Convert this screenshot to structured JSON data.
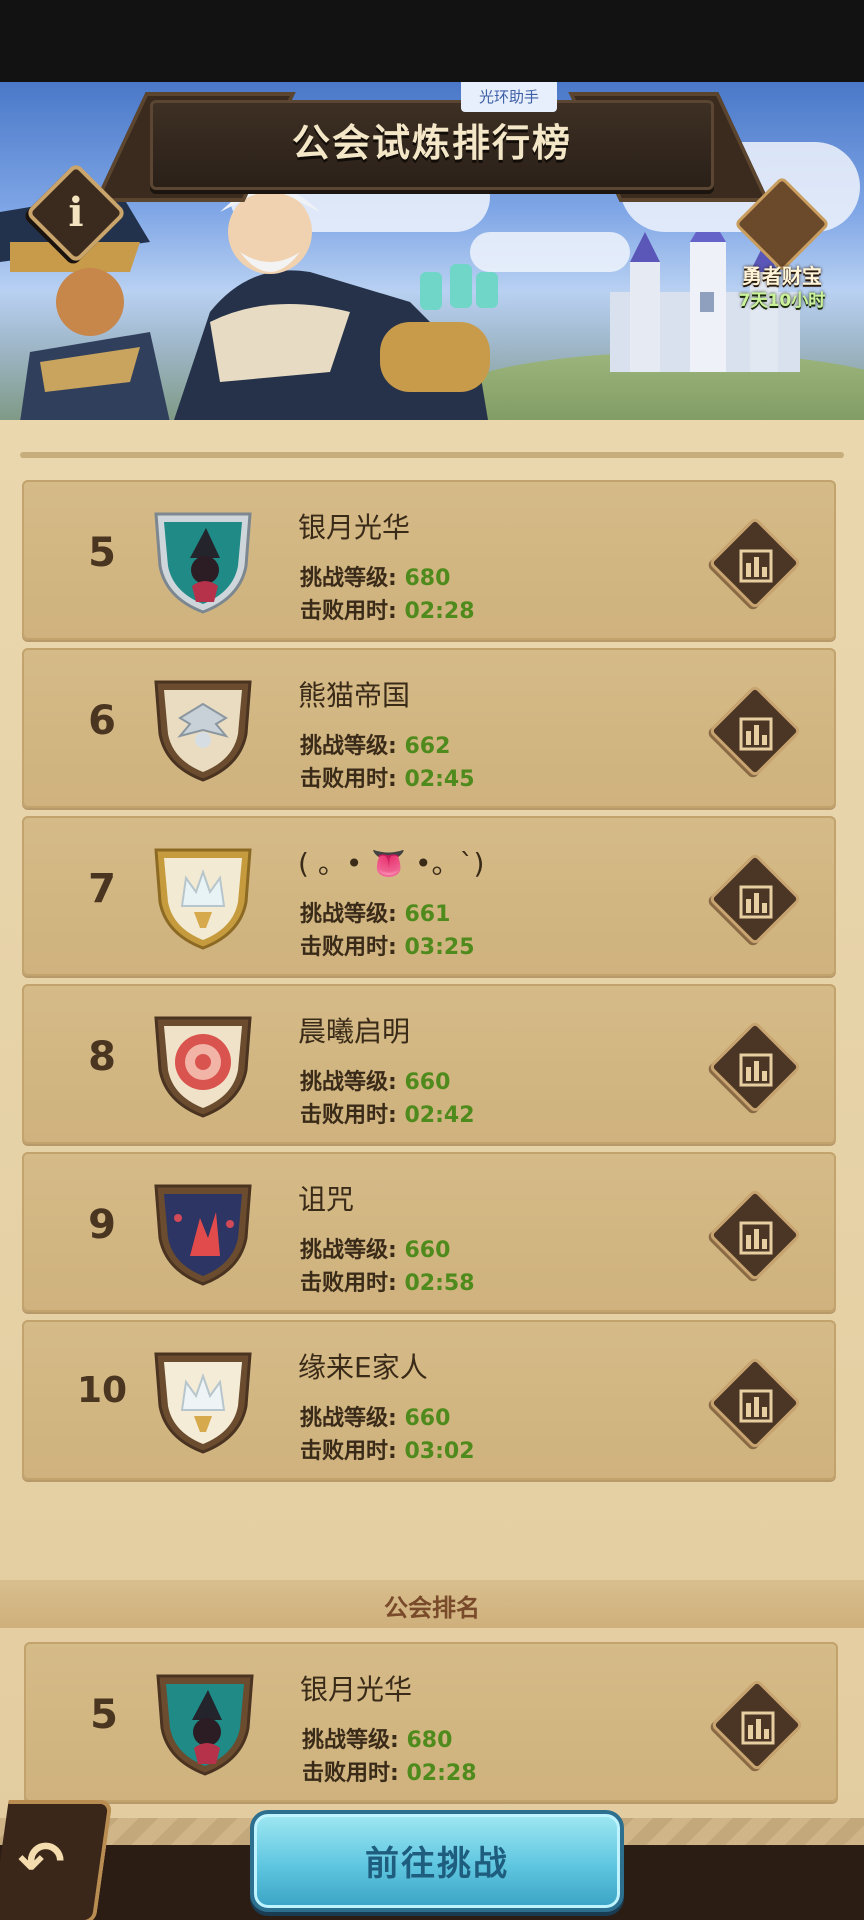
{
  "header": {
    "title": "公会试炼排行榜",
    "helper_tag": "光环助手",
    "info_label": "i"
  },
  "treasure": {
    "label": "勇者财宝",
    "time_left": "7天10小时"
  },
  "ranking": [
    {
      "rank": "5",
      "name": "银月光华",
      "level_label": "挑战等级:",
      "level": "680",
      "time_label": "击败用时:",
      "time": "02:28",
      "emblem": "teal-witch-emblem"
    },
    {
      "rank": "6",
      "name": "熊猫帝国",
      "level_label": "挑战等级:",
      "level": "662",
      "time_label": "击败用时:",
      "time": "02:45",
      "emblem": "silver-wing-emblem"
    },
    {
      "rank": "7",
      "name": "( 。• 👅 •。`)",
      "level_label": "挑战等级:",
      "level": "661",
      "time_label": "击败用时:",
      "time": "03:25",
      "emblem": "gold-crown-emblem"
    },
    {
      "rank": "8",
      "name": "晨曦启明",
      "level_label": "挑战等级:",
      "level": "660",
      "time_label": "击败用时:",
      "time": "02:42",
      "emblem": "red-target-emblem"
    },
    {
      "rank": "9",
      "name": "诅咒",
      "level_label": "挑战等级:",
      "level": "660",
      "time_label": "击败用时:",
      "time": "02:58",
      "emblem": "navy-flame-emblem"
    },
    {
      "rank": "10",
      "name": "缘来E家人",
      "level_label": "挑战等级:",
      "level": "660",
      "time_label": "击败用时:",
      "time": "03:02",
      "emblem": "white-crown-emblem"
    }
  ],
  "guild_section": {
    "title": "公会排名",
    "entry": {
      "rank": "5",
      "name": "银月光华",
      "level_label": "挑战等级:",
      "level": "680",
      "time_label": "击败用时:",
      "time": "02:28",
      "emblem": "teal-witch-emblem"
    }
  },
  "footer": {
    "back_label": "↶",
    "challenge_label": "前往挑战"
  },
  "colors": {
    "panel": "#e3cda0",
    "card": "#d2b682",
    "value_green": "#4e8a1c",
    "title_text": "#f4e7c8",
    "button_cyan": "#5fc6e0"
  }
}
